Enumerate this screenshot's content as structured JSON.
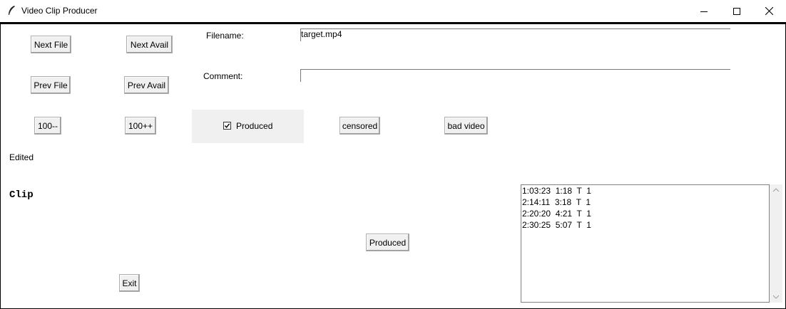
{
  "window": {
    "title": "Video Clip Producer",
    "controls": {
      "minimize": "minimize-icon",
      "maximize": "maximize-icon",
      "close": "close-icon"
    }
  },
  "buttons": {
    "next_file": "Next File",
    "next_avail": "Next Avail",
    "prev_file": "Prev File",
    "prev_avail": "Prev Avail",
    "minus_100": "100--",
    "plus_100": "100++",
    "censored": "censored",
    "bad_video": "bad video",
    "produced": "Produced",
    "exit": "Exit"
  },
  "fields": {
    "filename_label": "Filename:",
    "filename_value": "target.mp4",
    "comment_label": "Comment:",
    "comment_value": ""
  },
  "checkbox": {
    "label": "Produced",
    "checked": true
  },
  "status": {
    "edited": "Edited",
    "clip_heading": "Clip"
  },
  "clip_list": [
    "1:03:23  1:18  T  1",
    "2:14:11  3:18  T  1",
    "2:20:20  4:21  T  1",
    "2:30:25  5:07  T  1"
  ]
}
